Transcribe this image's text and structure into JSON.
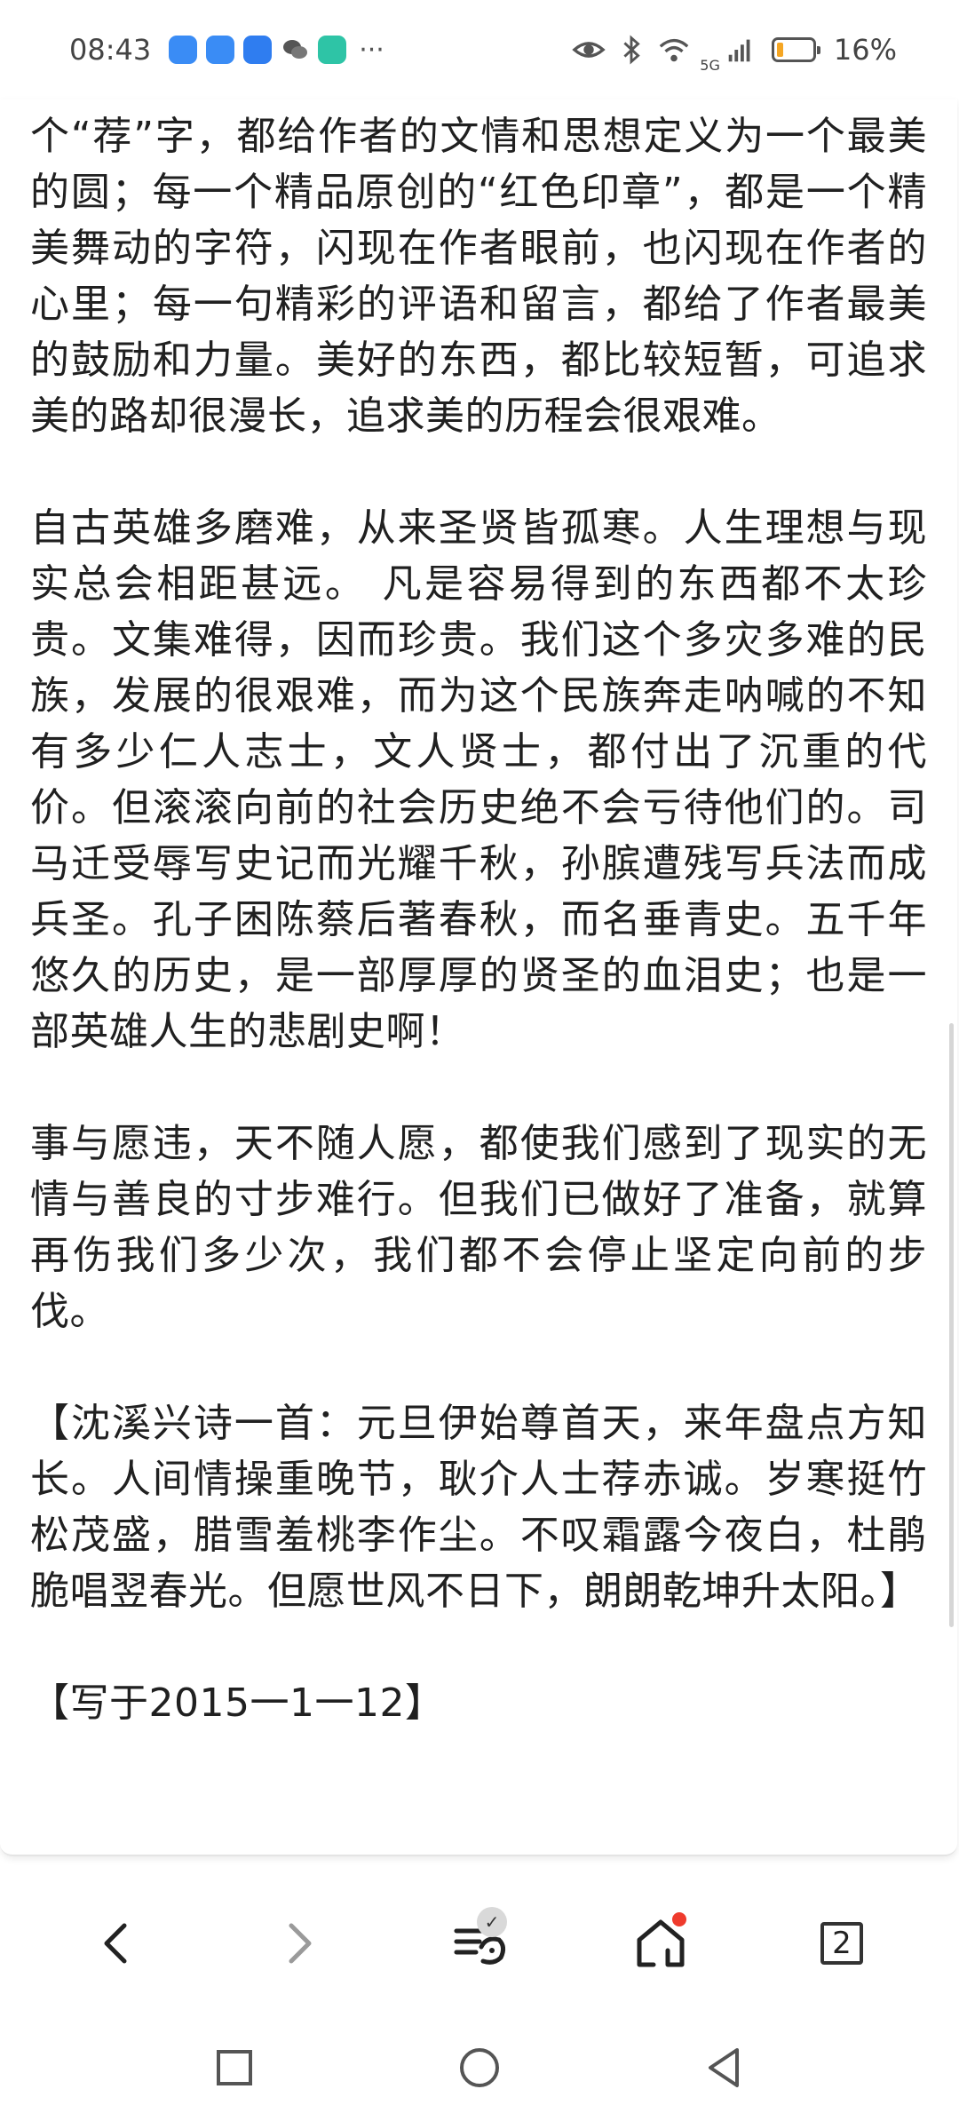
{
  "status_bar": {
    "time": "08:43",
    "network": "5G",
    "battery_text": "16%",
    "battery_level": 0.16,
    "more": "···",
    "icons": [
      "app-icon-1",
      "app-icon-2",
      "app-icon-3",
      "wechat-icon",
      "reader-icon",
      "eye-icon",
      "bluetooth-icon",
      "wifi-icon",
      "signal-icon",
      "battery-icon"
    ]
  },
  "article": {
    "paragraphs": [
      "个“荐”字，都给作者的文情和思想定义为一个最美的圆；每一个精品原创的“红色印章”，都是一个精美舞动的字符，闪现在作者眼前，也闪现在作者的心里；每一句精彩的评语和留言，都给了作者最美的鼓励和力量。美好的东西，都比较短暂，可追求美的路却很漫长，追求美的历程会很艰难。",
      "自古英雄多磨难，从来圣贤皆孤寒。人生理想与现实总会相距甚远。 凡是容易得到的东西都不太珍贵。文集难得，因而珍贵。我们这个多灾多难的民族，发展的很艰难，而为这个民族奔走呐喊的不知有多少仁人志士，文人贤士，都付出了沉重的代价。但滚滚向前的社会历史绝不会亏待他们的。司马迁受辱写史记而光耀千秋，孙膑遭残写兵法而成兵圣。孔子困陈蔡后著春秋，而名垂青史。五千年悠久的历史，是一部厚厚的贤圣的血泪史；也是一部英雄人生的悲剧史啊！",
      "事与愿违，天不随人愿，都使我们感到了现实的无情与善良的寸步难行。但我们已做好了准备，就算再伤我们多少次，我们都不会停止坚定向前的步伐。",
      "【沈溪兴诗一首：元旦伊始尊首天，来年盘点方知长。人间情操重晚节，耿介人士荐赤诚。岁寒挺竹松茂盛，腊雪羞桃李作尘。不叹霜露今夜白，杜鹃脆唱翌春光。但愿世风不日下，朗朗乾坤升太阳。】",
      "【写于2015一1一12】"
    ]
  },
  "toolbar": {
    "tab_count": "2",
    "check_mark": "✓",
    "buttons": [
      "back",
      "forward",
      "reading-mode",
      "home",
      "tabs"
    ]
  },
  "colors": {
    "accent_red": "#ef3b2d",
    "battery_orange": "#f5a623"
  }
}
